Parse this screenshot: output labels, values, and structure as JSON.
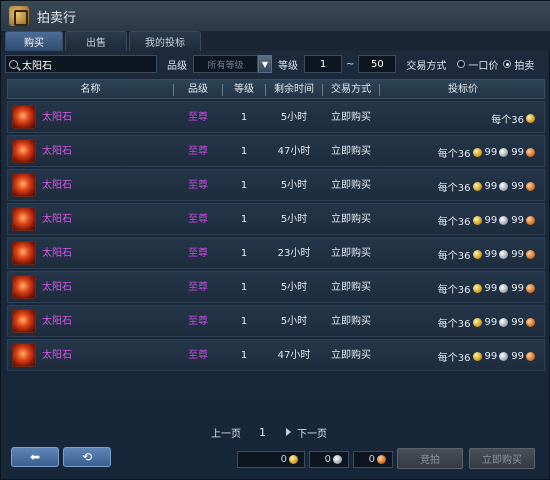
{
  "window": {
    "title": "拍卖行"
  },
  "tabs": [
    {
      "label": "购买",
      "active": true
    },
    {
      "label": "出售",
      "active": false
    },
    {
      "label": "我的投标",
      "active": false
    }
  ],
  "filters": {
    "search_value": "太阳石",
    "grade_label": "品级",
    "grade_select": "所有等级",
    "level_label": "等级",
    "level_min": "1",
    "level_sep": "~",
    "level_max": "50",
    "trade_label": "交易方式",
    "opt_buyout": "一口价",
    "opt_auction": "拍卖",
    "selected_option": "拍卖"
  },
  "columns": [
    "名称",
    "品级",
    "等级",
    "剩余时间",
    "交易方式",
    "投标价"
  ],
  "rows": [
    {
      "name": "太阳石",
      "grade": "至尊",
      "level": "1",
      "time": "5小时",
      "trade": "立即购买",
      "price_prefix": "每个36",
      "gold": "",
      "silver": "",
      "bronze": ""
    },
    {
      "name": "太阳石",
      "grade": "至尊",
      "level": "1",
      "time": "47小时",
      "trade": "立即购买",
      "price_prefix": "每个36",
      "gold": "99",
      "silver": "99",
      "bronze": ""
    },
    {
      "name": "太阳石",
      "grade": "至尊",
      "level": "1",
      "time": "5小时",
      "trade": "立即购买",
      "price_prefix": "每个36",
      "gold": "99",
      "silver": "99",
      "bronze": ""
    },
    {
      "name": "太阳石",
      "grade": "至尊",
      "level": "1",
      "time": "5小时",
      "trade": "立即购买",
      "price_prefix": "每个36",
      "gold": "99",
      "silver": "99",
      "bronze": ""
    },
    {
      "name": "太阳石",
      "grade": "至尊",
      "level": "1",
      "time": "23小时",
      "trade": "立即购买",
      "price_prefix": "每个36",
      "gold": "99",
      "silver": "99",
      "bronze": ""
    },
    {
      "name": "太阳石",
      "grade": "至尊",
      "level": "1",
      "time": "5小时",
      "trade": "立即购买",
      "price_prefix": "每个36",
      "gold": "99",
      "silver": "99",
      "bronze": ""
    },
    {
      "name": "太阳石",
      "grade": "至尊",
      "level": "1",
      "time": "5小时",
      "trade": "立即购买",
      "price_prefix": "每个36",
      "gold": "99",
      "silver": "99",
      "bronze": ""
    },
    {
      "name": "太阳石",
      "grade": "至尊",
      "level": "1",
      "time": "47小时",
      "trade": "立即购买",
      "price_prefix": "每个36",
      "gold": "99",
      "silver": "99",
      "bronze": ""
    }
  ],
  "pagination": {
    "prev": "上一页",
    "current": "1",
    "next": "下一页"
  },
  "bottom": {
    "gold_value": "0",
    "silver_value": "0",
    "bronze_value": "0",
    "bid_button": "竞拍",
    "buy_button": "立即购买"
  },
  "colors": {
    "item_name": "#d858e8",
    "grade": "#c848e0",
    "active_tab": "#4d6e98"
  }
}
